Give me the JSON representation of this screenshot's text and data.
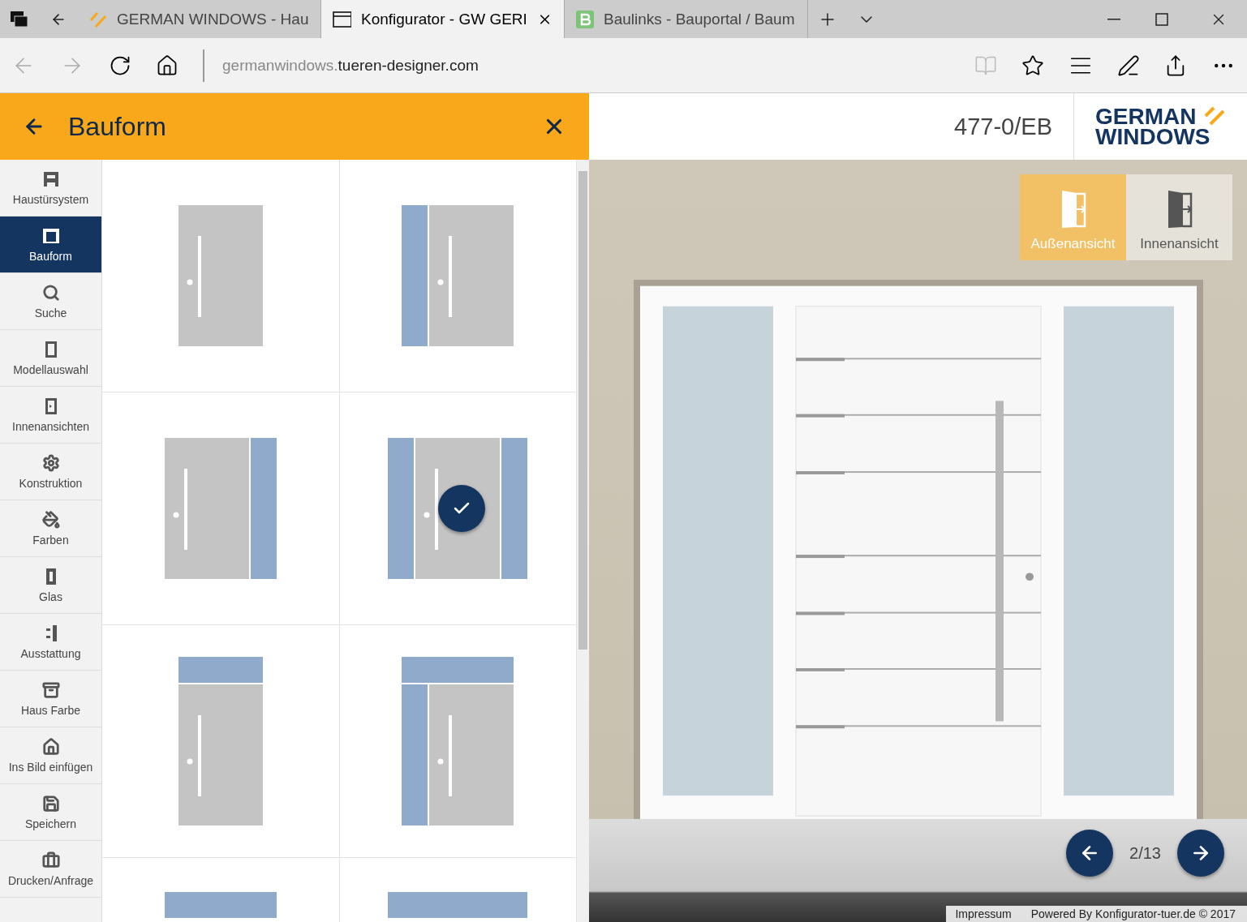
{
  "browser": {
    "tabs": [
      {
        "title": "GERMAN WINDOWS - Hau",
        "selected": false
      },
      {
        "title": "Konfigurator - GW GERI",
        "selected": true
      },
      {
        "title": "Baulinks - Bauportal / Baum",
        "selected": false
      }
    ],
    "url_domain": "germanwindows.",
    "url_rest": "tueren-designer.com"
  },
  "panel": {
    "title": "Bauform"
  },
  "sidebar": {
    "items": [
      {
        "label": "Haustürsystem",
        "selected": false
      },
      {
        "label": "Bauform",
        "selected": true
      },
      {
        "label": "Suche",
        "selected": false
      },
      {
        "label": "Modellauswahl",
        "selected": false
      },
      {
        "label": "Innenansichten",
        "selected": false
      },
      {
        "label": "Konstruktion",
        "selected": false
      },
      {
        "label": "Farben",
        "selected": false
      },
      {
        "label": "Glas",
        "selected": false
      },
      {
        "label": "Ausstattung",
        "selected": false
      },
      {
        "label": "Haus Farbe",
        "selected": false
      },
      {
        "label": "Ins Bild einfügen",
        "selected": false
      },
      {
        "label": "Speichern",
        "selected": false
      },
      {
        "label": "Drucken/Anfrage",
        "selected": false
      }
    ]
  },
  "options": [
    {
      "kind": "single",
      "selected": false
    },
    {
      "kind": "sidelight-left",
      "selected": false
    },
    {
      "kind": "sidelight-right",
      "selected": false
    },
    {
      "kind": "sidelights-both",
      "selected": true
    },
    {
      "kind": "transom",
      "selected": false
    },
    {
      "kind": "transom-sidelight-left",
      "selected": false
    },
    {
      "kind": "transom-cut-narrow"
    },
    {
      "kind": "transom-cut-wide"
    }
  ],
  "model": "477-0/EB",
  "logo": {
    "line1": "GERMAN",
    "line2": "WINDOWS"
  },
  "views": [
    {
      "label": "Außenansicht",
      "selected": true
    },
    {
      "label": "Innenansicht",
      "selected": false
    }
  ],
  "pager": "2/13",
  "footer": {
    "link": "Impressum",
    "credit": "Powered By Konfigurator-tuer.de © 2017"
  }
}
